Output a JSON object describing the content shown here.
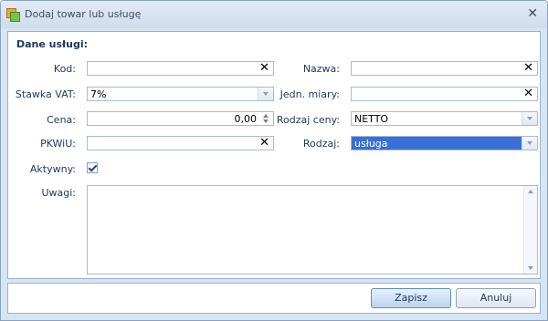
{
  "window": {
    "title": "Dodaj towar lub usługę"
  },
  "section": {
    "title": "Dane usługi:"
  },
  "labels": {
    "kod": "Kod:",
    "stawka_vat": "Stawka VAT:",
    "cena": "Cena:",
    "pkwiu": "PKWiU:",
    "aktywny": "Aktywny:",
    "uwagi": "Uwagi:",
    "nazwa": "Nazwa:",
    "jedn_miary": "Jedn. miary:",
    "rodzaj_ceny": "Rodzaj ceny:",
    "rodzaj": "Rodzaj:"
  },
  "fields": {
    "kod": "",
    "stawka_vat": "7%",
    "cena": "0,00",
    "pkwiu": "",
    "nazwa": "",
    "jedn_miary": "",
    "rodzaj_ceny": "NETTO",
    "rodzaj": "usługa",
    "uwagi": "",
    "aktywny_checked": true
  },
  "buttons": {
    "save": "Zapisz",
    "cancel": "Anuluj"
  },
  "icons": {
    "close": "close-icon",
    "clear": "clear-x-icon",
    "dropdown": "chevron-down-icon"
  }
}
